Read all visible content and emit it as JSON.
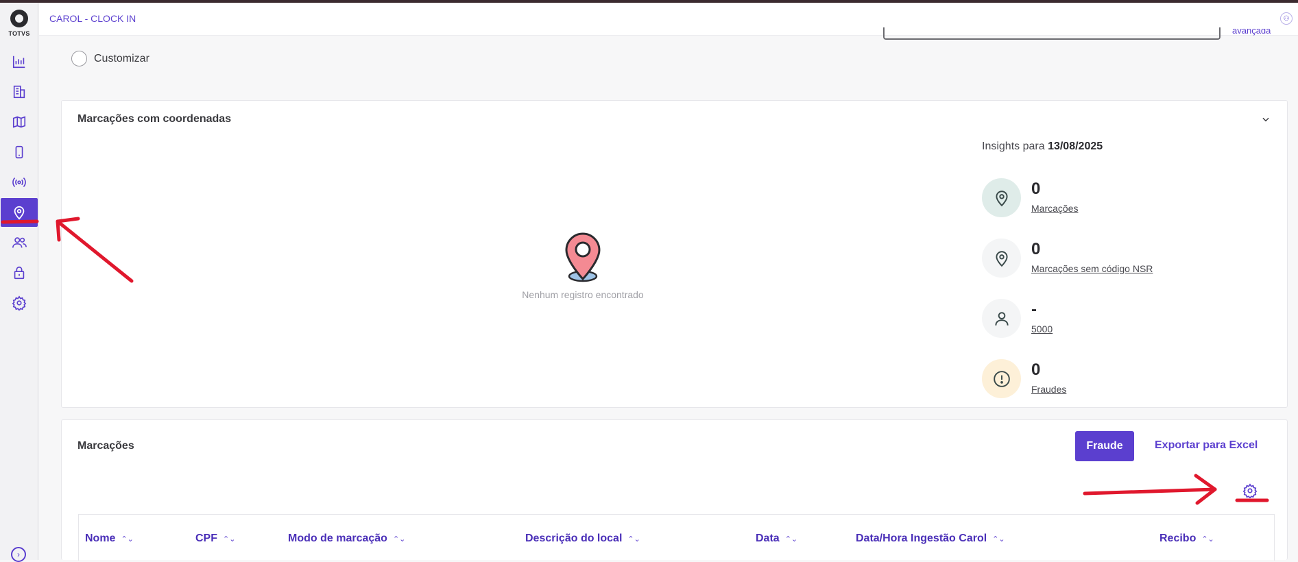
{
  "app": {
    "title": "CAROL - CLOCK IN",
    "brand": "TOTVS",
    "accent": "#5b3fcf"
  },
  "sidebar": {
    "items": [
      {
        "name": "dashboard",
        "icon": "bar-chart-icon",
        "active": false
      },
      {
        "name": "companies",
        "icon": "building-icon",
        "active": false
      },
      {
        "name": "map",
        "icon": "map-icon",
        "active": false
      },
      {
        "name": "devices",
        "icon": "mobile-icon",
        "active": false
      },
      {
        "name": "broadcast",
        "icon": "broadcast-icon",
        "active": false
      },
      {
        "name": "locations",
        "icon": "location-pin-icon",
        "active": true
      },
      {
        "name": "users",
        "icon": "users-icon",
        "active": false
      },
      {
        "name": "security",
        "icon": "lock-icon",
        "active": false
      },
      {
        "name": "settings",
        "icon": "gear-icon",
        "active": false
      }
    ],
    "expand_icon": "chevron-right-circle-icon"
  },
  "filters": {
    "customize_label": "Customizar",
    "clipped_link": "avançada"
  },
  "map_card": {
    "title": "Marcações com coordenadas",
    "empty_message": "Nenhum registro encontrado",
    "insights": {
      "prefix": "Insights para",
      "date": "13/08/2025",
      "items": [
        {
          "value": "0",
          "label": "Marcações",
          "icon": "location-pin-icon",
          "bg": "#dfece9"
        },
        {
          "value": "0",
          "label": "Marcações sem código NSR",
          "icon": "location-pin-icon",
          "bg": "#f4f5f6"
        },
        {
          "value": "-",
          "label": "5000",
          "icon": "user-icon",
          "bg": "#f4f5f6"
        },
        {
          "value": "0",
          "label": "Fraudes",
          "icon": "alert-circle-icon",
          "bg": "#fdf0d8"
        }
      ]
    }
  },
  "marks_card": {
    "title": "Marcações",
    "fraud_button": "Fraude",
    "export_link": "Exportar para Excel",
    "columns": [
      "Nome",
      "CPF",
      "Modo de marcação",
      "Descrição do local",
      "Data",
      "Data/Hora Ingestão Carol",
      "Recibo"
    ]
  },
  "annotations": {
    "color": "#e0182d"
  }
}
